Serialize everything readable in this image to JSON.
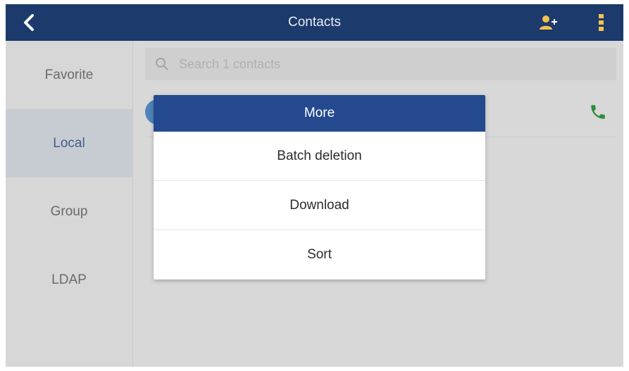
{
  "header": {
    "title": "Contacts",
    "back_icon": "chevron-left-icon",
    "add_contact_icon": "add-contact-icon",
    "more_icon": "more-vertical-icon"
  },
  "sidebar": {
    "items": [
      {
        "label": "Favorite",
        "active": false
      },
      {
        "label": "Local",
        "active": true
      },
      {
        "label": "Group",
        "active": false
      },
      {
        "label": "LDAP",
        "active": false
      }
    ]
  },
  "search": {
    "placeholder": "Search 1 contacts",
    "icon": "search-icon"
  },
  "contact": {
    "avatar_color": "#4f83b9",
    "call_icon": "phone-icon",
    "call_color": "#2e8b3a"
  },
  "dialog": {
    "title": "More",
    "options": [
      "Batch deletion",
      "Download",
      "Sort"
    ]
  },
  "colors": {
    "header_bg": "#1c3a6b",
    "dialog_header_bg": "#24498f",
    "active_tab_text": "#425e8c"
  }
}
